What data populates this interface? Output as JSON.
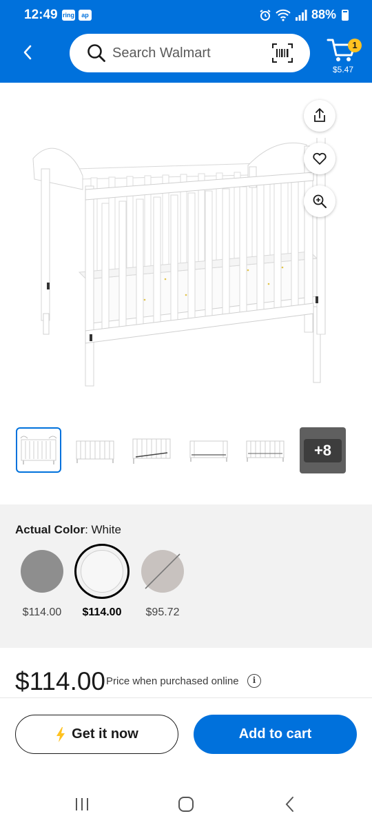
{
  "status_bar": {
    "time": "12:49",
    "app_icons": [
      "ring",
      "ring-app"
    ],
    "app_icon_labels": [
      "ring",
      "ap"
    ],
    "battery": "88%"
  },
  "header": {
    "search_placeholder": "Search Walmart",
    "cart_count": "1",
    "cart_total": "$5.47",
    "background_color": "#0071dc"
  },
  "product_image": {
    "actions": [
      "share-icon",
      "heart-icon",
      "zoom-icon"
    ],
    "thumbnails_more_label": "+8",
    "thumbnail_count": 5
  },
  "color_selector": {
    "label": "Actual Color",
    "separator": ": ",
    "value": "White",
    "options": [
      {
        "color": "#8e8e8e",
        "price": "$114.00",
        "selected": false,
        "unavailable": false
      },
      {
        "color": "#f7f7f7",
        "price": "$114.00",
        "selected": true,
        "unavailable": false
      },
      {
        "color": "#c8c2bf",
        "price": "$95.72",
        "selected": false,
        "unavailable": true
      }
    ]
  },
  "pricing": {
    "price": "$114.00",
    "note": "Price when purchased online",
    "info_icon": "i"
  },
  "actions": {
    "get_it_now": "Get it now",
    "add_to_cart": "Add to cart",
    "accent_color": "#0071dc",
    "lightning_color": "#ffc220"
  },
  "system_nav": [
    "recents-icon",
    "home-icon",
    "back-icon"
  ]
}
